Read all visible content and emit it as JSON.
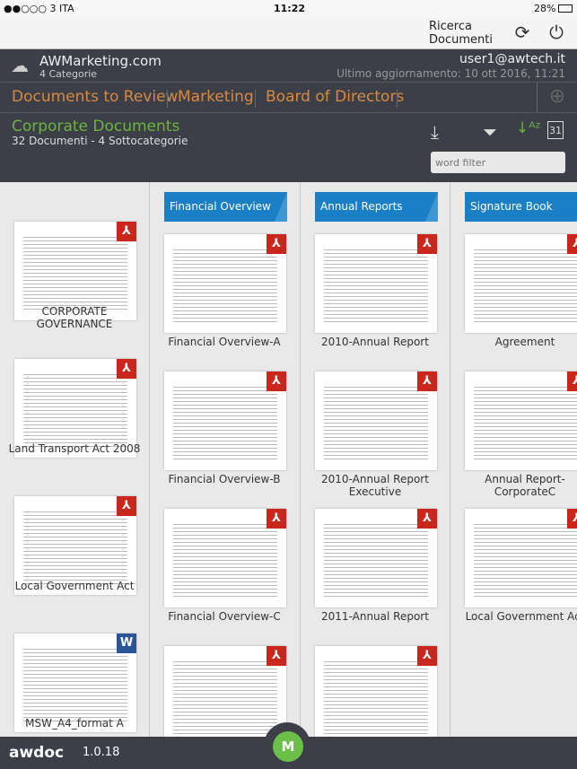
{
  "status": {
    "carrier": "●●○○○ 3 ITA",
    "time": "11:22",
    "battery": "28%"
  },
  "topbar": {
    "search_label_1": "Ricerca",
    "search_label_2": "Documenti"
  },
  "account": {
    "name": "AWMarketing.com",
    "categories": "4 Categorie",
    "user": "user1@awtech.it",
    "last_update": "Ultimo aggiornamento: 10 ott 2016, 11:21"
  },
  "tabs": [
    "Documents to Review",
    "Marketing",
    "Board of Directors"
  ],
  "category": {
    "title": "Corporate Documents",
    "subtitle": "32 Documenti - 4 Sottocategorie",
    "filter_placeholder": "word filter"
  },
  "columns": [
    {
      "header": "",
      "items": [
        {
          "label": "CORPORATE GOVERNANCE",
          "type": "pdf"
        },
        {
          "label": "Land Transport Act 2008",
          "type": "pdf"
        },
        {
          "label": "Local Government Act",
          "type": "pdf"
        },
        {
          "label": "MSW_A4_format A",
          "type": "word"
        }
      ]
    },
    {
      "header": "Financial Overview",
      "items": [
        {
          "label": "Financial Overview-A",
          "type": "pdf"
        },
        {
          "label": "Financial Overview-B",
          "type": "pdf"
        },
        {
          "label": "Financial Overview-C",
          "type": "pdf"
        },
        {
          "label": "",
          "type": "pdf"
        }
      ]
    },
    {
      "header": "Annual Reports",
      "items": [
        {
          "label": "2010-Annual Report",
          "type": "pdf"
        },
        {
          "label": "2010-Annual Report Executive",
          "type": "pdf"
        },
        {
          "label": "2011-Annual Report",
          "type": "pdf"
        },
        {
          "label": "",
          "type": "pdf"
        }
      ]
    },
    {
      "header": "Signature Book",
      "items": [
        {
          "label": "Agreement",
          "type": "pdf"
        },
        {
          "label": "Annual Report-CorporateC",
          "type": "pdf"
        },
        {
          "label": "Local Government Act",
          "type": "pdf"
        }
      ]
    }
  ],
  "footer": {
    "brand": "awdoc",
    "version": "1.0.18",
    "avatar": "M"
  },
  "colors": {
    "tab": "#d8893f",
    "category": "#6db33f",
    "chip": "#1b7fc5",
    "header_bg": "#3c3f48",
    "avatar": "#6cc04a"
  }
}
